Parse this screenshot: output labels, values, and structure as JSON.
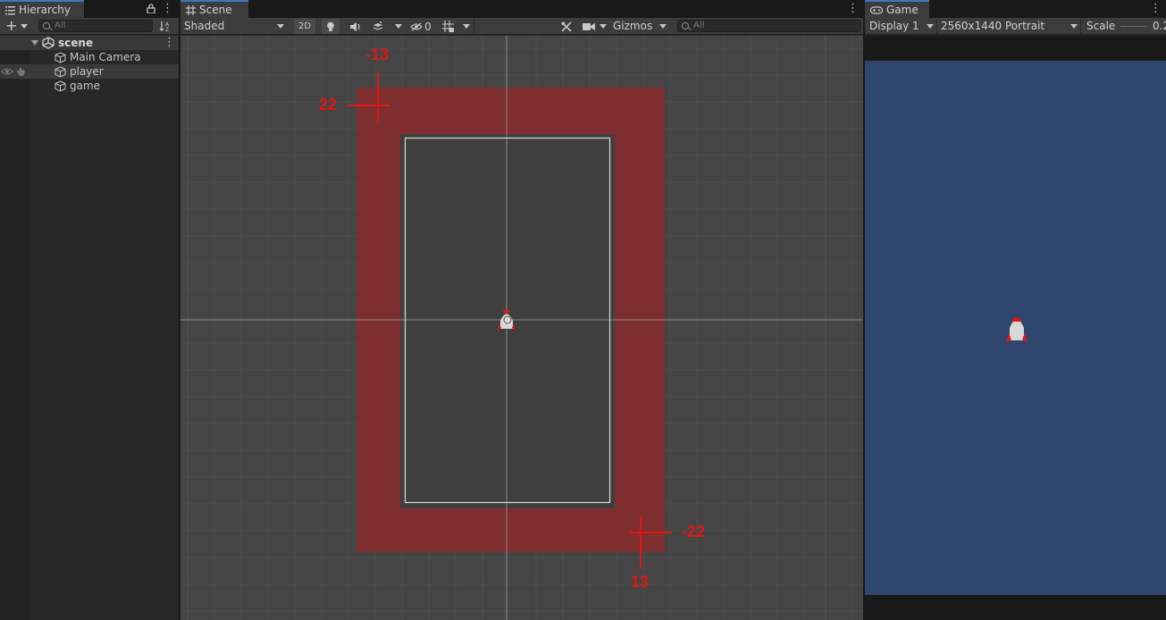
{
  "hierarchy": {
    "tab_label": "Hierarchy",
    "search_placeholder": "All",
    "scene_name": "scene",
    "items": [
      {
        "label": "Main Camera"
      },
      {
        "label": "player"
      },
      {
        "label": "game"
      }
    ]
  },
  "scene": {
    "tab_label": "Scene",
    "shading_mode": "Shaded",
    "mode_2d_label": "2D",
    "hidden_count": "0",
    "gizmos_label": "Gizmos",
    "search_placeholder": "All",
    "labels": {
      "top_left_x": "-13",
      "top_left_y": "22",
      "bottom_right_y": "-22",
      "bottom_right_x": "13"
    },
    "colors": {
      "bounds_fill": "#7e2e2e",
      "marker_red": "#e01515",
      "grid_bg": "#454545"
    }
  },
  "game": {
    "tab_label": "Game",
    "display": "Display 1",
    "resolution": "2560x1440 Portrait",
    "scale_label": "Scale",
    "scale_value": "0.2",
    "colors": {
      "background": "#2f466f"
    }
  }
}
